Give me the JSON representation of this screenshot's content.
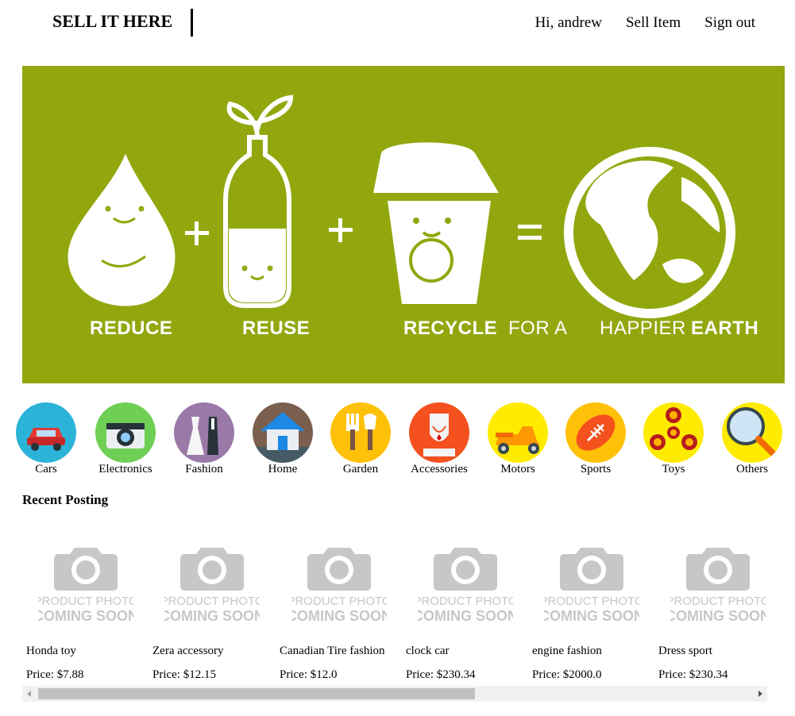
{
  "header": {
    "brand": "SELL IT HERE",
    "nav": {
      "greeting": "Hi, andrew",
      "sell": "Sell Item",
      "signout": "Sign out"
    }
  },
  "hero": {
    "words": {
      "reduce": "REDUCE",
      "reuse": "REUSE",
      "recycle": "RECYCLE",
      "fora": "FOR A",
      "happier": "HAPPIER",
      "earth": "EARTH"
    },
    "colors": {
      "background": "#92a70e",
      "foreground": "#ffffff"
    }
  },
  "categories": [
    {
      "label": "Cars",
      "icon": "car-icon",
      "color": "#2bb3d8"
    },
    {
      "label": "Electronics",
      "icon": "camera-icon",
      "color": "#6fcf55"
    },
    {
      "label": "Fashion",
      "icon": "clothes-icon",
      "color": "#9a79a8"
    },
    {
      "label": "Home",
      "icon": "house-icon",
      "color": "#7a5e4e"
    },
    {
      "label": "Garden",
      "icon": "garden-tools-icon",
      "color": "#ffc107"
    },
    {
      "label": "Accessories",
      "icon": "necklace-icon",
      "color": "#f4511e"
    },
    {
      "label": "Motors",
      "icon": "scooter-icon",
      "color": "#ffeb00"
    },
    {
      "label": "Sports",
      "icon": "football-icon",
      "color": "#ffc107"
    },
    {
      "label": "Toys",
      "icon": "fidget-spinner-icon",
      "color": "#ffeb00"
    },
    {
      "label": "Others",
      "icon": "magnifier-icon",
      "color": "#ffeb00"
    }
  ],
  "recent_title": "Recent Posting",
  "placeholder": {
    "line1": "PRODUCT PHOTO",
    "line2": "COMING SOON"
  },
  "products": [
    {
      "name": "Honda toy",
      "price": "Price: $7.88"
    },
    {
      "name": "Zera accessory",
      "price": "Price: $12.15"
    },
    {
      "name": "Canadian Tire fashion",
      "price": "Price: $12.0"
    },
    {
      "name": "clock car",
      "price": "Price: $230.34"
    },
    {
      "name": "engine fashion",
      "price": "Price: $2000.0"
    },
    {
      "name": "Dress sport",
      "price": "Price: $230.34"
    }
  ]
}
